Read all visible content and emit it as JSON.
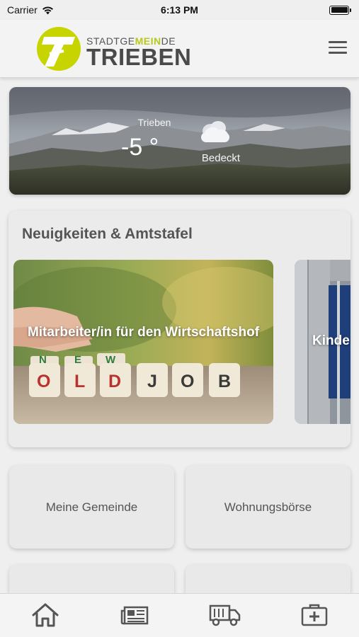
{
  "status_bar": {
    "carrier": "Carrier",
    "time": "6:13 PM"
  },
  "header": {
    "logo_top_prefix": "STADTGE",
    "logo_top_highlight": "MEIN",
    "logo_top_suffix": "DE",
    "logo_bottom": "TRIEBEN",
    "menu_icon": "hamburger-menu-icon"
  },
  "weather": {
    "city": "Trieben",
    "temperature": "-5 °",
    "condition": "Bedeckt",
    "icon": "cloud-icon"
  },
  "news": {
    "title": "Neuigkeiten & Amtstafel",
    "items": [
      {
        "label": "Mitarbeiter/in für den Wirtschaftshof"
      },
      {
        "label": "Kinde"
      }
    ],
    "dice_top": [
      "N",
      "E",
      "W"
    ],
    "dice_bottom": [
      "O",
      "L",
      "D",
      "J",
      "O",
      "B"
    ]
  },
  "tiles": [
    {
      "label": "Meine Gemeinde"
    },
    {
      "label": "Wohnungsbörse"
    },
    {
      "label": ""
    },
    {
      "label": ""
    }
  ],
  "tabbar": [
    {
      "icon": "home-icon"
    },
    {
      "icon": "newspaper-icon"
    },
    {
      "icon": "truck-icon"
    },
    {
      "icon": "first-aid-icon"
    }
  ],
  "colors": {
    "accent": "#c8d400",
    "text": "#555555",
    "background": "#efefef"
  }
}
